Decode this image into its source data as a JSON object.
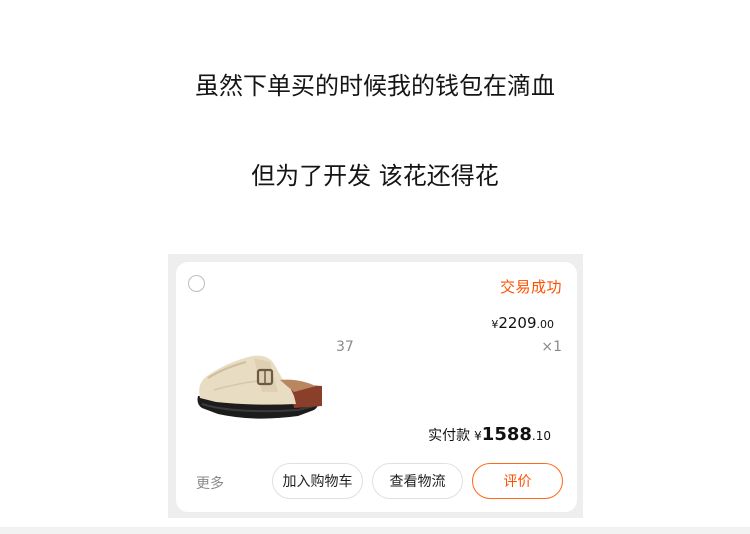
{
  "captions": {
    "line1": "虽然下单买的时候我的钱包在滴血",
    "line2": "但为了开发 该花还得花"
  },
  "order": {
    "status": "交易成功",
    "price": {
      "currency": "¥",
      "integer": "2209",
      "decimal": ".00"
    },
    "size": "37",
    "quantity": "×1",
    "paid": {
      "label": "实付款",
      "currency": "¥",
      "integer": "1588",
      "decimal": ".10"
    },
    "more": "更多",
    "buttons": {
      "add_to_cart": "加入购物车",
      "view_logistics": "查看物流",
      "review": "评价"
    },
    "accent_color": "#ff5000"
  }
}
